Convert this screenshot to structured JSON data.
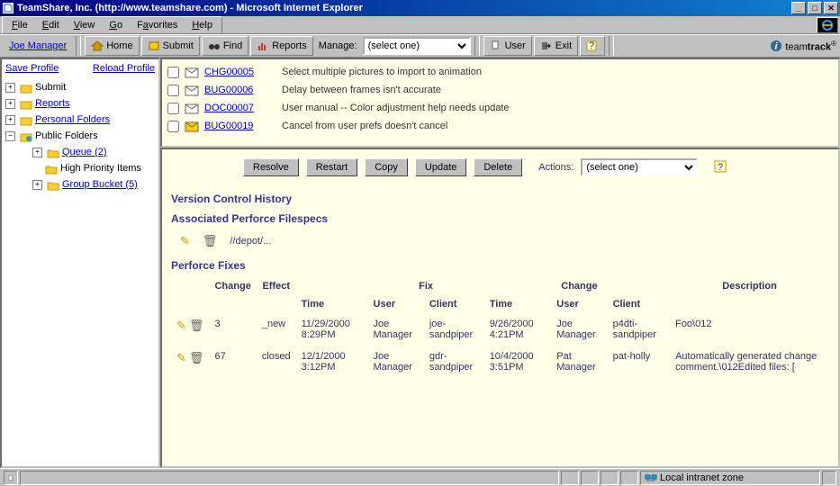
{
  "window": {
    "title": "TeamShare, Inc. (http://www.teamshare.com) - Microsoft Internet Explorer"
  },
  "menubar": {
    "items": [
      "File",
      "Edit",
      "View",
      "Go",
      "Favorites",
      "Help"
    ]
  },
  "appbar": {
    "user": "Joe Manager",
    "home": "Home",
    "submit": "Submit",
    "find": "Find",
    "reports": "Reports",
    "manage_label": "Manage:",
    "manage_select": "(select one)",
    "user_btn": "User",
    "exit": "Exit",
    "brand_prefix": "team",
    "brand_suffix": "track"
  },
  "sidebar": {
    "save": "Save Profile",
    "reload": "Reload Profile",
    "submit": "Submit",
    "reports": "Reports",
    "personal": "Personal Folders",
    "public": "Public Folders",
    "queue": "Queue (2)",
    "high": "High Priority Items",
    "group": "Group Bucket (5)"
  },
  "issues": [
    {
      "id": "CHG00005",
      "desc": "Select multiple pictures to import to animation",
      "open": false
    },
    {
      "id": "BUG00006",
      "desc": "Delay between frames isn't accurate",
      "open": false
    },
    {
      "id": "DOC00007",
      "desc": "User manual -- Color adjustment help needs update",
      "open": false
    },
    {
      "id": "BUG00019",
      "desc": "Cancel from user prefs doesn't cancel",
      "open": true
    }
  ],
  "actions": {
    "resolve": "Resolve",
    "restart": "Restart",
    "copy": "Copy",
    "update": "Update",
    "delete": "Delete",
    "label": "Actions:",
    "select": "(select one)"
  },
  "sections": {
    "vch": "Version Control History",
    "apf": "Associated Perforce Filespecs",
    "pf": "Perforce Fixes",
    "filespec_path": "//depot/..."
  },
  "fixes": {
    "headers": {
      "change": "Change",
      "effect": "Effect",
      "time": "Time",
      "fix_user": "Fix User",
      "client": "Client",
      "change_user": "Change User",
      "description": "Description"
    },
    "rows": [
      {
        "change": "3",
        "effect": "_new",
        "time1": "11/29/2000 8:29PM",
        "fix_user": "Joe Manager",
        "client1": "joe-sandpiper",
        "time2": "9/26/2000 4:21PM",
        "change_user": "Joe Manager",
        "client2": "p4dti-sandpiper",
        "desc": "Foo\\012"
      },
      {
        "change": "67",
        "effect": "closed",
        "time1": "12/1/2000 3:12PM",
        "fix_user": "Joe Manager",
        "client1": "gdr-sandpiper",
        "time2": "10/4/2000 3:51PM",
        "change_user": "Pat Manager",
        "client2": "pat-holly",
        "desc": "Automatically generated change comment.\\012Edited files: ["
      }
    ]
  },
  "statusbar": {
    "zone": "Local intranet zone"
  }
}
